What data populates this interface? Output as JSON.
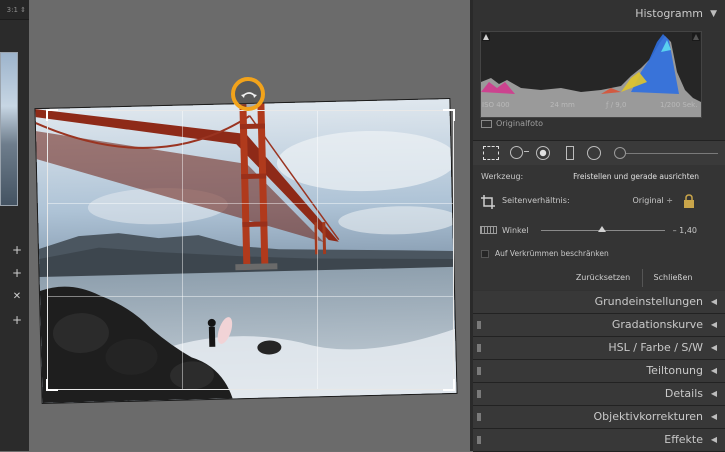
{
  "filmstrip": {
    "zoom_label": "3:1 ⇕"
  },
  "histogram": {
    "title": "Histogramm",
    "iso": "ISO 400",
    "focal": "24 mm",
    "aperture": "ƒ / 9,0",
    "shutter": "1/200 Sek.",
    "original_label": "Originalfoto"
  },
  "crop_tool": {
    "werkzeug_label": "Werkzeug:",
    "werkzeug_value": "Freistellen und gerade ausrichten",
    "aspect_label": "Seitenverhältnis:",
    "aspect_value": "Original ÷",
    "angle_label": "Winkel",
    "angle_value": "– 1,40",
    "constrain_label": "Auf Verkrümmen beschränken",
    "reset_button": "Zurücksetzen",
    "close_button": "Schließen"
  },
  "panels": [
    {
      "label": "Grundeinstellungen"
    },
    {
      "label": "Gradationskurve"
    },
    {
      "label": "HSL / Farbe / S/W"
    },
    {
      "label": "Teiltonung"
    },
    {
      "label": "Details"
    },
    {
      "label": "Objektivkorrekturen"
    },
    {
      "label": "Effekte"
    }
  ],
  "colors": {
    "accent": "#f2a31b",
    "panel_bg": "#323232",
    "canvas_bg": "#6b6b6b"
  }
}
